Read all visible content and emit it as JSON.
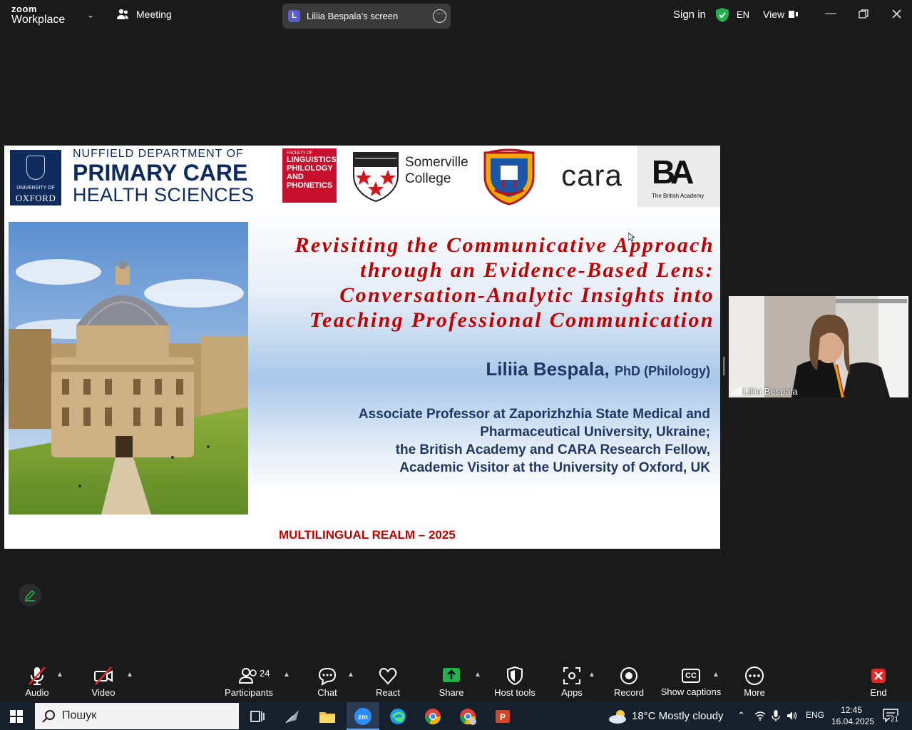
{
  "app": {
    "brand_line1": "zoom",
    "brand_line2": "Workplace",
    "meeting_label": "Meeting",
    "share_initial": "L",
    "share_label": "Liliia Bespala's screen",
    "signin_label": "Sign in",
    "language": "EN",
    "view_label": "View",
    "security_color": "#22b14c"
  },
  "slide": {
    "nuffield_line1": "NUFFIELD DEPARTMENT OF",
    "nuffield_line2": "PRIMARY CARE",
    "nuffield_line3": "HEALTH SCIENCES",
    "oxford_small": "UNIVERSITY OF",
    "oxford_big": "OXFORD",
    "faculty_small": "FACULTY OF",
    "faculty_lines": [
      "LINGUISTICS,",
      "PHILOLOGY",
      "AND",
      "PHONETICS"
    ],
    "somerville_lines": [
      "Somerville",
      "College"
    ],
    "cara_label": "cara",
    "ba_mark": "BA",
    "ba_label": "The British Academy",
    "title_lines": [
      "Revisiting the Communicative Approach",
      "through an Evidence-Based Lens:",
      "Conversation-Analytic Insights into",
      "Teaching Professional Communication"
    ],
    "author_name": "Liliia Bespala,",
    "author_degree": "PhD (Philology)",
    "affiliation_lines": [
      "Associate Professor at Zaporizhzhia State Medical and",
      "Pharmaceutical University, Ukraine;",
      "the British Academy and CARA Research Fellow,",
      "Academic Visitor at the University of Oxford, UK"
    ],
    "conference": "MULTILINGUAL REALM – 2025",
    "title_color": "#c00000",
    "text_color": "#1f3864"
  },
  "video_tile": {
    "participant_name": "Liliia Bespala"
  },
  "toolbar": {
    "audio": "Audio",
    "video": "Video",
    "participants": "Participants",
    "participants_count": "24",
    "chat": "Chat",
    "react": "React",
    "share": "Share",
    "host_tools": "Host tools",
    "apps": "Apps",
    "record": "Record",
    "captions": "Show captions",
    "captions_icon_text": "CC",
    "more": "More",
    "end": "End",
    "share_color": "#22b14c",
    "end_color": "#e02828"
  },
  "taskbar": {
    "search_placeholder": "Пошук",
    "weather": "18°C  Mostly cloudy",
    "lang": "ENG",
    "time": "12:45",
    "date": "16.04.2025",
    "notifications": "21"
  }
}
